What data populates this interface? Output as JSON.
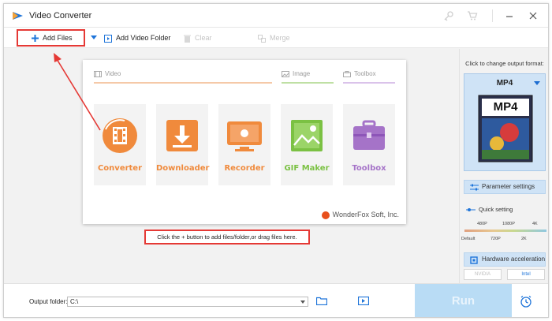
{
  "window": {
    "title": "Video Converter",
    "titlebar_icons": [
      "key-icon",
      "cart-icon",
      "minimize-icon",
      "close-icon"
    ]
  },
  "toolbar": {
    "add_files": "Add Files",
    "add_video_folder": "Add Video Folder",
    "clear": "Clear",
    "merge": "Merge"
  },
  "launcher": {
    "sections": {
      "video": "Video",
      "image": "Image",
      "toolbox": "Toolbox"
    },
    "tiles": [
      {
        "label": "Converter",
        "color": "#f08a3c",
        "icon": "film-icon"
      },
      {
        "label": "Downloader",
        "color": "#f08a3c",
        "icon": "download-icon"
      },
      {
        "label": "Recorder",
        "color": "#f08a3c",
        "icon": "screen-record-icon"
      },
      {
        "label": "GIF Maker",
        "color": "#7bc143",
        "icon": "image-icon"
      },
      {
        "label": "Toolbox",
        "color": "#a573c8",
        "icon": "toolbox-icon"
      }
    ],
    "brand": "WonderFox Soft, Inc."
  },
  "hint": "Click the + button to add files/folder,or drag files here.",
  "side": {
    "change_format_hint": "Click to change output format:",
    "format_name": "MP4",
    "format_badge": "MP4",
    "parameter_settings": "Parameter settings",
    "quick_setting": "Quick setting",
    "quality_top": [
      "480P",
      "1080P",
      "4K"
    ],
    "quality_bottom": [
      "Default",
      "720P",
      "2K"
    ],
    "hardware_acceleration": "Hardware acceleration",
    "nvidia": "NVIDIA",
    "intel": "Intel"
  },
  "bottom": {
    "output_folder_label": "Output folder:",
    "output_folder_value": "C:\\",
    "run": "Run"
  },
  "colors": {
    "accent_orange": "#f08a3c",
    "accent_green": "#7bc143",
    "accent_purple": "#a573c8",
    "highlight_red": "#e53935",
    "selection_blue": "#cfe3f6"
  }
}
